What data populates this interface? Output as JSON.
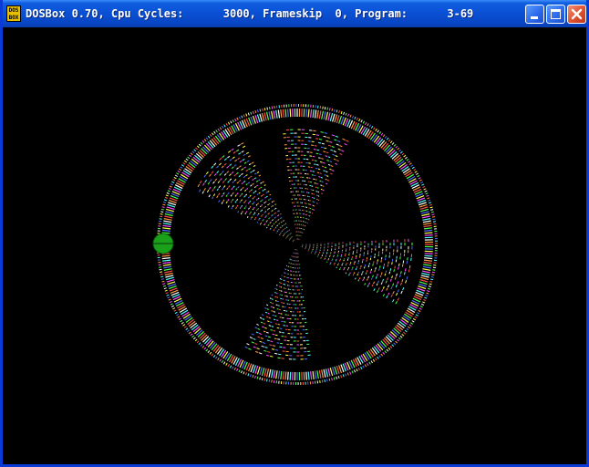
{
  "window": {
    "title": "DOSBox 0.70, Cpu Cycles:      3000, Frameskip  0, Program:      3-69",
    "icon_text_line1": "DOS",
    "icon_text_line2": "BOX",
    "controls": {
      "minimize_icon": "minimize-icon",
      "maximize_icon": "maximize-icon",
      "close_icon": "close-icon"
    }
  },
  "colors": {
    "titlebar": "#0a4fd3",
    "frame": "#0a3bd7",
    "background": "#000000",
    "close_button": "#e0502e",
    "ball": "#1aa01a"
  },
  "graphics": {
    "pattern": "rotating rainbow wheel with four fan-shaped blades",
    "ring_colors": [
      "#ff4d4d",
      "#4dff4d",
      "#4d6bff",
      "#ffff4d",
      "#ff4dff",
      "#4dffff",
      "#ffffff",
      "#ff9a3c"
    ],
    "ball_icon": "green-ball"
  }
}
